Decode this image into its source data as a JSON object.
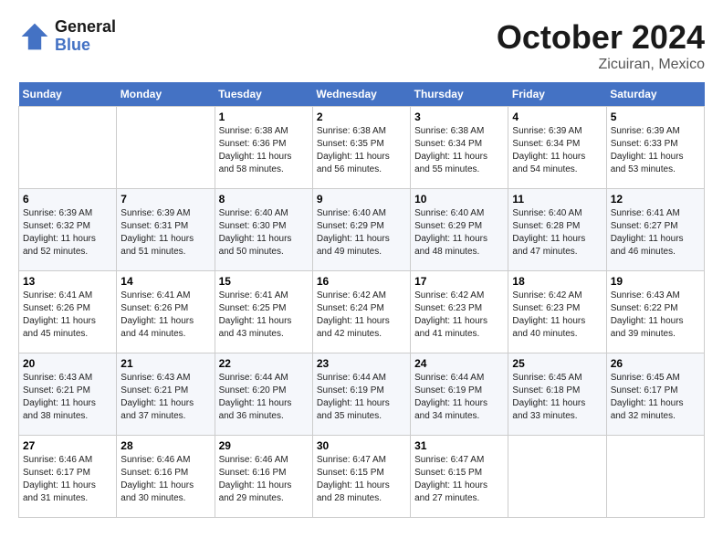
{
  "header": {
    "logo_general": "General",
    "logo_blue": "Blue",
    "month": "October 2024",
    "location": "Zicuiran, Mexico"
  },
  "weekdays": [
    "Sunday",
    "Monday",
    "Tuesday",
    "Wednesday",
    "Thursday",
    "Friday",
    "Saturday"
  ],
  "weeks": [
    [
      {
        "day": "",
        "info": ""
      },
      {
        "day": "",
        "info": ""
      },
      {
        "day": "1",
        "info": "Sunrise: 6:38 AM\nSunset: 6:36 PM\nDaylight: 11 hours and 58 minutes."
      },
      {
        "day": "2",
        "info": "Sunrise: 6:38 AM\nSunset: 6:35 PM\nDaylight: 11 hours and 56 minutes."
      },
      {
        "day": "3",
        "info": "Sunrise: 6:38 AM\nSunset: 6:34 PM\nDaylight: 11 hours and 55 minutes."
      },
      {
        "day": "4",
        "info": "Sunrise: 6:39 AM\nSunset: 6:34 PM\nDaylight: 11 hours and 54 minutes."
      },
      {
        "day": "5",
        "info": "Sunrise: 6:39 AM\nSunset: 6:33 PM\nDaylight: 11 hours and 53 minutes."
      }
    ],
    [
      {
        "day": "6",
        "info": "Sunrise: 6:39 AM\nSunset: 6:32 PM\nDaylight: 11 hours and 52 minutes."
      },
      {
        "day": "7",
        "info": "Sunrise: 6:39 AM\nSunset: 6:31 PM\nDaylight: 11 hours and 51 minutes."
      },
      {
        "day": "8",
        "info": "Sunrise: 6:40 AM\nSunset: 6:30 PM\nDaylight: 11 hours and 50 minutes."
      },
      {
        "day": "9",
        "info": "Sunrise: 6:40 AM\nSunset: 6:29 PM\nDaylight: 11 hours and 49 minutes."
      },
      {
        "day": "10",
        "info": "Sunrise: 6:40 AM\nSunset: 6:29 PM\nDaylight: 11 hours and 48 minutes."
      },
      {
        "day": "11",
        "info": "Sunrise: 6:40 AM\nSunset: 6:28 PM\nDaylight: 11 hours and 47 minutes."
      },
      {
        "day": "12",
        "info": "Sunrise: 6:41 AM\nSunset: 6:27 PM\nDaylight: 11 hours and 46 minutes."
      }
    ],
    [
      {
        "day": "13",
        "info": "Sunrise: 6:41 AM\nSunset: 6:26 PM\nDaylight: 11 hours and 45 minutes."
      },
      {
        "day": "14",
        "info": "Sunrise: 6:41 AM\nSunset: 6:26 PM\nDaylight: 11 hours and 44 minutes."
      },
      {
        "day": "15",
        "info": "Sunrise: 6:41 AM\nSunset: 6:25 PM\nDaylight: 11 hours and 43 minutes."
      },
      {
        "day": "16",
        "info": "Sunrise: 6:42 AM\nSunset: 6:24 PM\nDaylight: 11 hours and 42 minutes."
      },
      {
        "day": "17",
        "info": "Sunrise: 6:42 AM\nSunset: 6:23 PM\nDaylight: 11 hours and 41 minutes."
      },
      {
        "day": "18",
        "info": "Sunrise: 6:42 AM\nSunset: 6:23 PM\nDaylight: 11 hours and 40 minutes."
      },
      {
        "day": "19",
        "info": "Sunrise: 6:43 AM\nSunset: 6:22 PM\nDaylight: 11 hours and 39 minutes."
      }
    ],
    [
      {
        "day": "20",
        "info": "Sunrise: 6:43 AM\nSunset: 6:21 PM\nDaylight: 11 hours and 38 minutes."
      },
      {
        "day": "21",
        "info": "Sunrise: 6:43 AM\nSunset: 6:21 PM\nDaylight: 11 hours and 37 minutes."
      },
      {
        "day": "22",
        "info": "Sunrise: 6:44 AM\nSunset: 6:20 PM\nDaylight: 11 hours and 36 minutes."
      },
      {
        "day": "23",
        "info": "Sunrise: 6:44 AM\nSunset: 6:19 PM\nDaylight: 11 hours and 35 minutes."
      },
      {
        "day": "24",
        "info": "Sunrise: 6:44 AM\nSunset: 6:19 PM\nDaylight: 11 hours and 34 minutes."
      },
      {
        "day": "25",
        "info": "Sunrise: 6:45 AM\nSunset: 6:18 PM\nDaylight: 11 hours and 33 minutes."
      },
      {
        "day": "26",
        "info": "Sunrise: 6:45 AM\nSunset: 6:17 PM\nDaylight: 11 hours and 32 minutes."
      }
    ],
    [
      {
        "day": "27",
        "info": "Sunrise: 6:46 AM\nSunset: 6:17 PM\nDaylight: 11 hours and 31 minutes."
      },
      {
        "day": "28",
        "info": "Sunrise: 6:46 AM\nSunset: 6:16 PM\nDaylight: 11 hours and 30 minutes."
      },
      {
        "day": "29",
        "info": "Sunrise: 6:46 AM\nSunset: 6:16 PM\nDaylight: 11 hours and 29 minutes."
      },
      {
        "day": "30",
        "info": "Sunrise: 6:47 AM\nSunset: 6:15 PM\nDaylight: 11 hours and 28 minutes."
      },
      {
        "day": "31",
        "info": "Sunrise: 6:47 AM\nSunset: 6:15 PM\nDaylight: 11 hours and 27 minutes."
      },
      {
        "day": "",
        "info": ""
      },
      {
        "day": "",
        "info": ""
      }
    ]
  ]
}
